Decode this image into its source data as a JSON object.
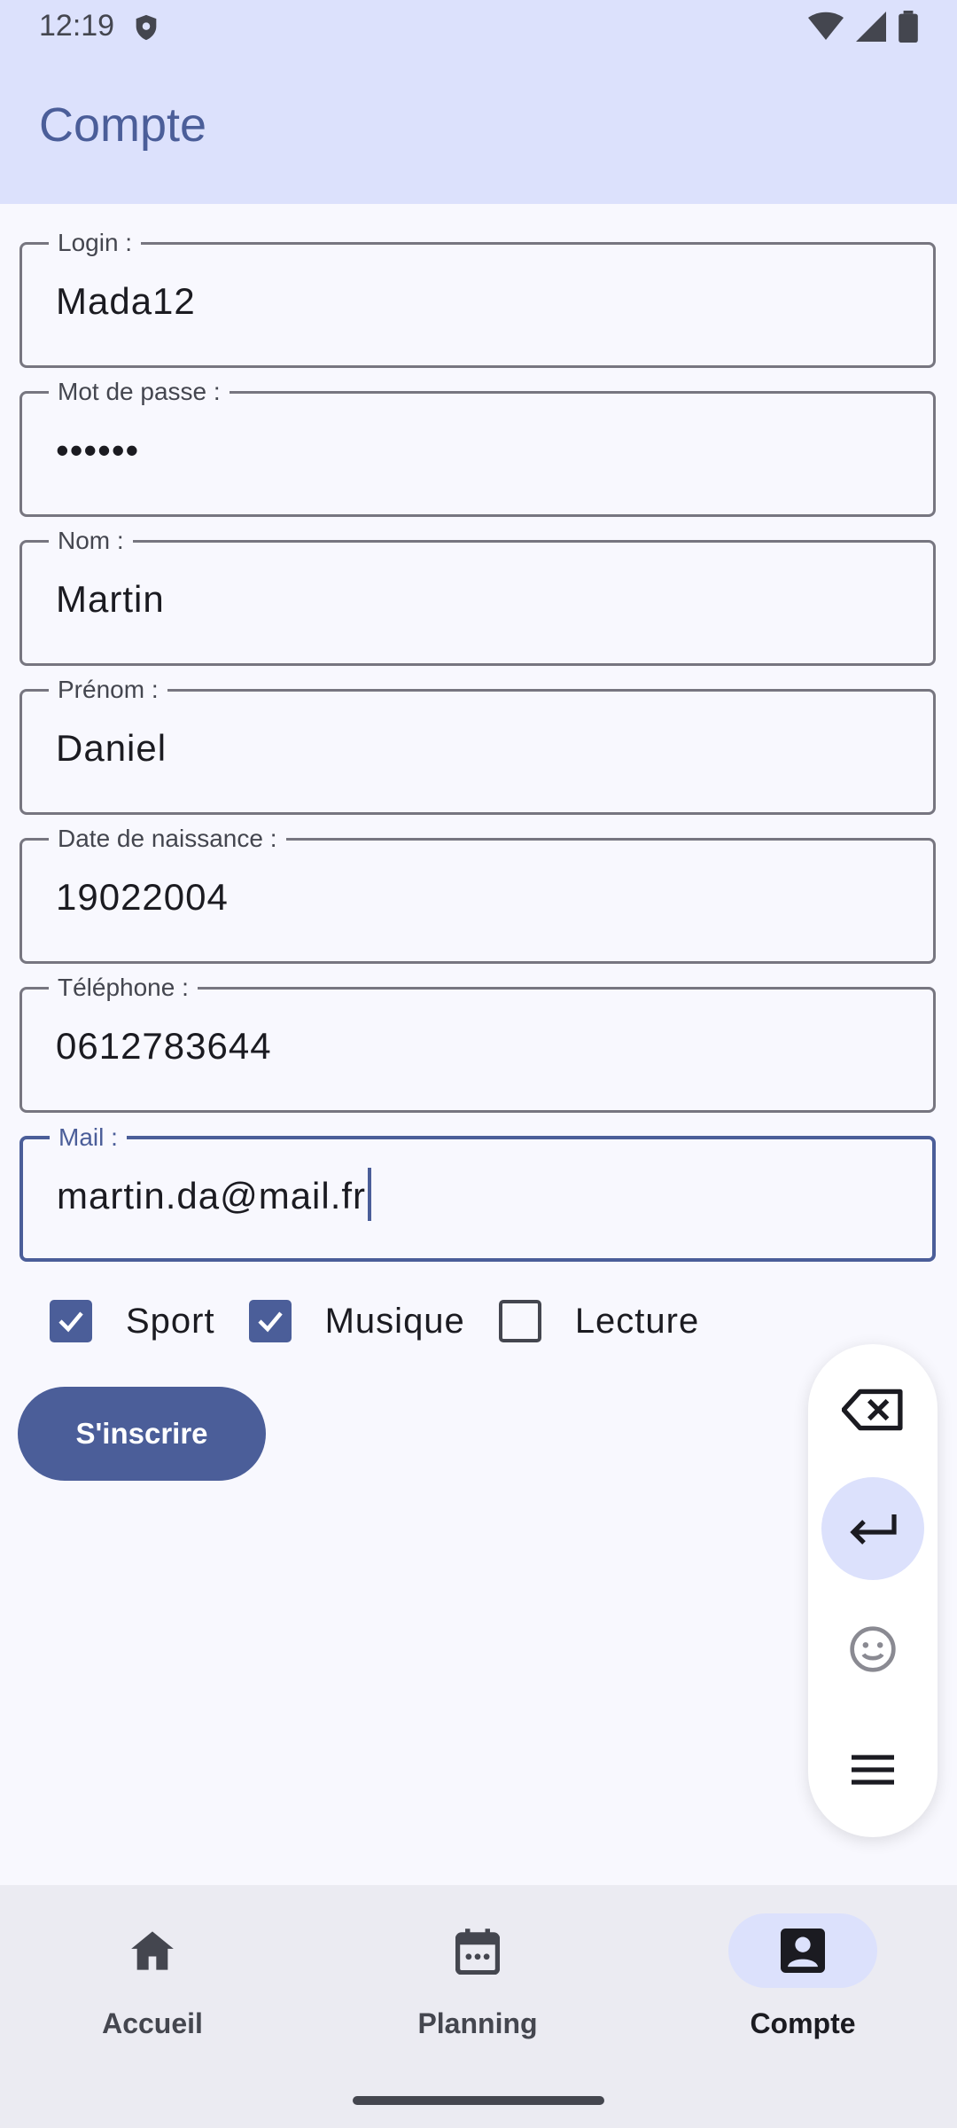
{
  "status_bar": {
    "time": "12:19"
  },
  "header": {
    "title": "Compte"
  },
  "form": {
    "fields": [
      {
        "label": "Login :",
        "value": "Mada12"
      },
      {
        "label": "Mot de passe :",
        "value": "••••••"
      },
      {
        "label": "Nom :",
        "value": "Martin"
      },
      {
        "label": "Prénom :",
        "value": "Daniel"
      },
      {
        "label": "Date de naissance :",
        "value": "19022004"
      },
      {
        "label": "Téléphone :",
        "value": "0612783644"
      },
      {
        "label": "Mail :",
        "value": "martin.da@mail.fr"
      }
    ],
    "checkboxes": [
      {
        "label": "Sport",
        "checked": true
      },
      {
        "label": "Musique",
        "checked": true
      },
      {
        "label": "Lecture",
        "checked": false
      }
    ],
    "submit_label": "S'inscrire"
  },
  "keyboard_toolbar": {
    "icons": [
      "backspace-icon",
      "enter-icon",
      "emoji-icon",
      "menu-icon"
    ]
  },
  "bottom_nav": {
    "items": [
      {
        "label": "Accueil",
        "icon": "home-icon",
        "active": false
      },
      {
        "label": "Planning",
        "icon": "calendar-icon",
        "active": false
      },
      {
        "label": "Compte",
        "icon": "account-icon",
        "active": true
      }
    ]
  },
  "colors": {
    "primary": "#4b5e99",
    "header_bg": "#dce1fc",
    "surface": "#f8f8fe",
    "nav_bg": "#ebebf2"
  }
}
